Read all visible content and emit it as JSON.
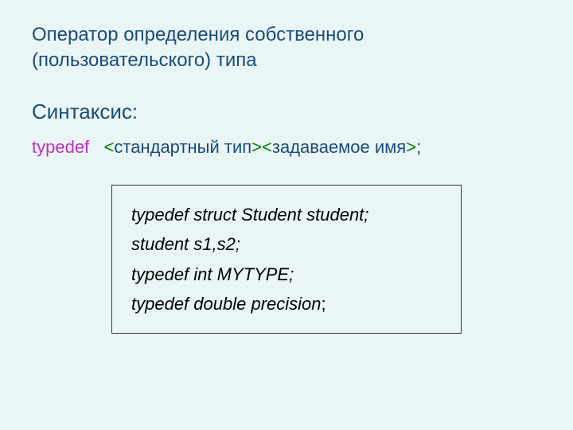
{
  "title_line1": "Оператор определения собственного",
  "title_line2": "(пользовательского) типа",
  "subheading": "Синтаксис:",
  "syntax": {
    "keyword": "typedef",
    "lt1": "<",
    "std_type": "стандартный тип",
    "gt1": ">",
    "lt2": "<",
    "given_name": "задаваемое имя",
    "gt2": ">",
    "semicolon": ";"
  },
  "code": {
    "l1": "typedef struct Student student;",
    "l2": "student s1,s2;",
    "l3": "typedef  int MYTYPE;",
    "l4_italic": "typedef double precision",
    "l4_plain": ";"
  }
}
